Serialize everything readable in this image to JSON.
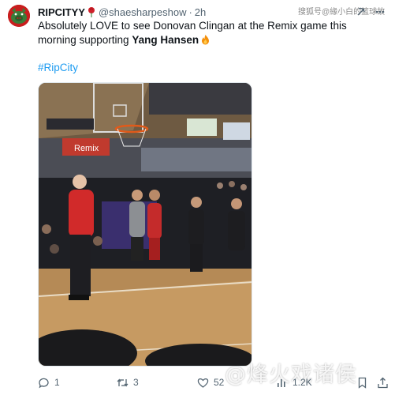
{
  "tweet": {
    "display_name": "RIPCITYY",
    "handle": "@shaesharpeshow",
    "separator": "·",
    "time": "2h",
    "text_part1": "Absolutely LOVE to see Donovan Clingan at the Remix game this morning supporting ",
    "text_bold": "Yang Hansen",
    "hashtag": "#RipCity",
    "media": {
      "banner_text": "Remix"
    }
  },
  "actions": {
    "replies": "1",
    "retweets": "3",
    "likes": "52",
    "views": "1.2K"
  },
  "watermarks": {
    "top": "搜狐号@緣小白的篮球故",
    "bottom": "@烽火戏诸侯"
  },
  "colors": {
    "link": "#1d9bf0",
    "muted": "#536471",
    "avatar": "#c81e1e"
  }
}
